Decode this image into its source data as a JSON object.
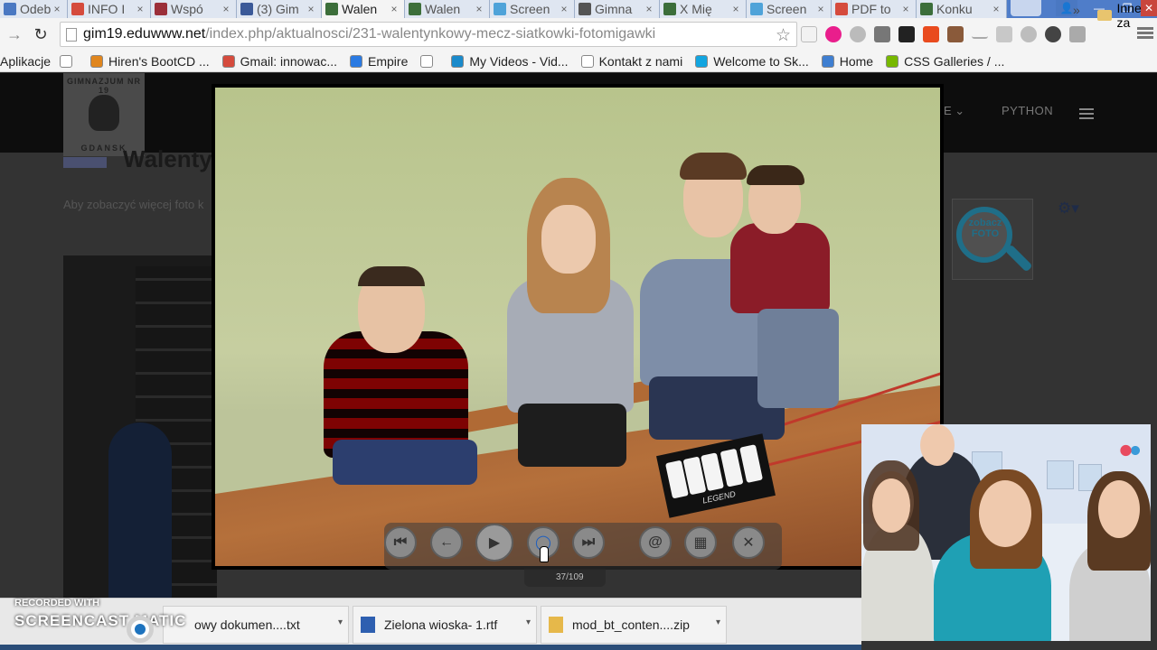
{
  "browser": {
    "tabs": [
      {
        "label": "Odebr",
        "color": "#4a78c2"
      },
      {
        "label": "INFO I",
        "color": "#d54b3d"
      },
      {
        "label": "Wspó",
        "color": "#9b2f3a"
      },
      {
        "label": "(3) Gim",
        "color": "#3b5998"
      },
      {
        "label": "Walen",
        "color": "#3c6e3a"
      },
      {
        "label": "Walen",
        "color": "#3c6e3a"
      },
      {
        "label": "Screen",
        "color": "#4fa3d9"
      },
      {
        "label": "Gimna",
        "color": "#555555"
      },
      {
        "label": "X Mię",
        "color": "#3c6e3a"
      },
      {
        "label": "Screen",
        "color": "#4fa3d9"
      },
      {
        "label": "PDF to",
        "color": "#d54b3d"
      },
      {
        "label": "Konku",
        "color": "#3c6e3a"
      }
    ],
    "tab_close_glyph": "×",
    "url_host": "gim19.eduwww.net",
    "url_path": "/index.php/aktualnosci/231-walentynkowy-mecz-siatkowki-fotomigawki",
    "bookmarks": [
      {
        "label": "Aplikacje",
        "icon": "apps-icon",
        "color": "#4a78c2"
      },
      {
        "label": "",
        "icon": "page-icon",
        "color": "#ffffff"
      },
      {
        "label": "Hiren's BootCD ...",
        "icon": "hirens-icon",
        "color": "#e0861e"
      },
      {
        "label": "Gmail: innowac...",
        "icon": "gmail-icon",
        "color": "#d54b3d"
      },
      {
        "label": "Empire",
        "icon": "empire-icon",
        "color": "#2a7ae2"
      },
      {
        "label": "",
        "icon": "page-icon",
        "color": "#ffffff"
      },
      {
        "label": "My Videos - Vid...",
        "icon": "vimeo-icon",
        "color": "#1a8acb"
      },
      {
        "label": "Kontakt z nami",
        "icon": "page-icon",
        "color": "#ffffff"
      },
      {
        "label": "Welcome to Sk...",
        "icon": "skype-icon",
        "color": "#12a5e0"
      },
      {
        "label": "Home",
        "icon": "home-globe-icon",
        "color": "#3f7fd1"
      },
      {
        "label": "CSS Galleries / ...",
        "icon": "css-galleries-icon",
        "color": "#77b800"
      }
    ],
    "bookmarks_more": "»",
    "other_bookmarks": "Inne za"
  },
  "site": {
    "logo_top": "GIMNAZJUM NR 19",
    "logo_bottom": "GDANSK",
    "nav_cut": "E ⌄",
    "nav_python": "PYTHON",
    "article_title": "Walenty",
    "article_intro": "Aby zobaczyć więcej foto k",
    "zobacz_label": "zobacz FOTO"
  },
  "lightbox": {
    "counter": "37/109",
    "controls": {
      "first": "⏮",
      "prev": "←",
      "play": "▶",
      "pause": "◯",
      "last": "⏭",
      "email": "@",
      "gallery": "▦",
      "close": "✕"
    },
    "scoreboard_brand": "LEGEND"
  },
  "downloads": [
    {
      "label": "owy dokumen....txt",
      "icon": "txt-file-icon",
      "color": "#9aa7b8"
    },
    {
      "label": "Zielona wioska- 1.rtf",
      "icon": "rtf-file-icon",
      "color": "#2e5fb0"
    },
    {
      "label": "mod_bt_conten....zip",
      "icon": "zip-file-icon",
      "color": "#e6b84a"
    }
  ],
  "downloads_arrow": "▾",
  "watermark": {
    "recorded_with": "RECORDED WITH",
    "brand": "SCREENCAST MATIC"
  },
  "colors": {
    "tab_strip": "#4f7dc9",
    "lightbox_bg": "#000000",
    "page_overlay": "#333333"
  }
}
